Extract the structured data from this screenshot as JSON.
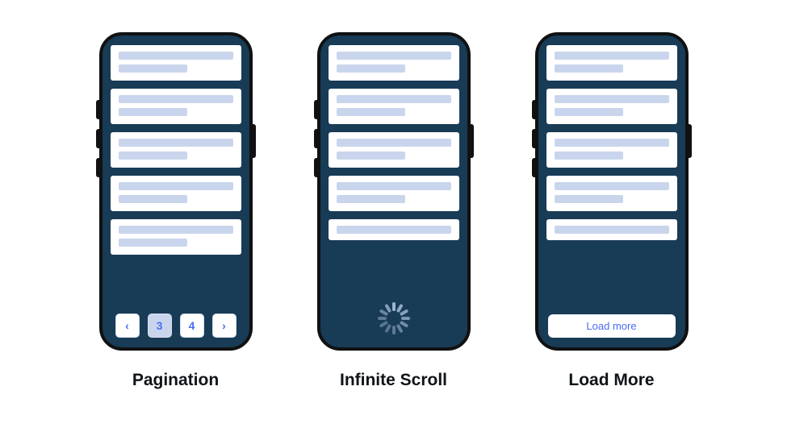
{
  "colors": {
    "phoneBackground": "#183B56",
    "phoneFrame": "#111111",
    "cardBackground": "#FFFFFF",
    "placeholderBar": "#C9D5EC",
    "accentBlue": "#4A6CF7",
    "spinnerSpoke": "#9CB3CF"
  },
  "phones": {
    "pagination": {
      "caption": "Pagination",
      "cardCount": 5,
      "pager": {
        "prevLabel": "‹",
        "nextLabel": "›",
        "currentPage": "3",
        "nextPage": "4"
      }
    },
    "infinite": {
      "caption": "Infinite Scroll",
      "cardCount": 5,
      "spinnerSpokes": 12
    },
    "loadmore": {
      "caption": "Load More",
      "cardCount": 5,
      "buttonLabel": "Load more"
    }
  }
}
